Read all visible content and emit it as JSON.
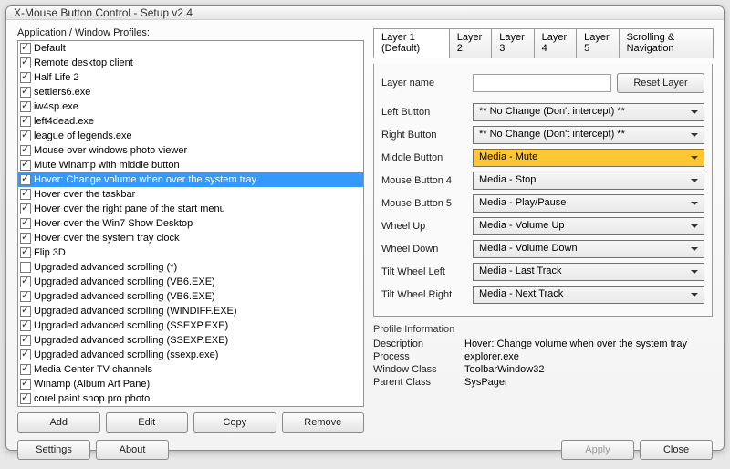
{
  "window": {
    "title": "X-Mouse Button Control - Setup v2.4"
  },
  "left": {
    "heading": "Application / Window Profiles:",
    "profiles": [
      {
        "label": "Default",
        "checked": true
      },
      {
        "label": "Remote desktop client",
        "checked": true
      },
      {
        "label": "Half Life 2",
        "checked": true
      },
      {
        "label": "settlers6.exe",
        "checked": true
      },
      {
        "label": "iw4sp.exe",
        "checked": true
      },
      {
        "label": "left4dead.exe",
        "checked": true
      },
      {
        "label": "league of legends.exe",
        "checked": true
      },
      {
        "label": "Mouse over windows photo viewer",
        "checked": true
      },
      {
        "label": "Mute Winamp with middle button",
        "checked": true
      },
      {
        "label": "Hover: Change volume when over the system tray",
        "checked": true,
        "selected": true
      },
      {
        "label": "Hover over the taskbar",
        "checked": true
      },
      {
        "label": "Hover over the right pane of the start menu",
        "checked": true
      },
      {
        "label": "Hover over the Win7 Show Desktop",
        "checked": true
      },
      {
        "label": "Hover over the system tray clock",
        "checked": true
      },
      {
        "label": "Flip 3D",
        "checked": true
      },
      {
        "label": "Upgraded advanced scrolling (*)",
        "checked": false
      },
      {
        "label": "Upgraded advanced scrolling (VB6.EXE)",
        "checked": true
      },
      {
        "label": "Upgraded advanced scrolling (VB6.EXE)",
        "checked": true
      },
      {
        "label": "Upgraded advanced scrolling (WINDIFF.EXE)",
        "checked": true
      },
      {
        "label": "Upgraded advanced scrolling (SSEXP.EXE)",
        "checked": true
      },
      {
        "label": "Upgraded advanced scrolling (SSEXP.EXE)",
        "checked": true
      },
      {
        "label": "Upgraded advanced scrolling (ssexp.exe)",
        "checked": true
      },
      {
        "label": "Media Center TV channels",
        "checked": true
      },
      {
        "label": "Winamp (Album Art Pane)",
        "checked": true
      },
      {
        "label": "corel paint shop pro photo",
        "checked": true
      }
    ],
    "buttons": {
      "add": "Add",
      "edit": "Edit",
      "copy": "Copy",
      "remove": "Remove"
    }
  },
  "tabs": {
    "items": [
      {
        "label": "Layer 1 (Default)",
        "active": true
      },
      {
        "label": "Layer 2"
      },
      {
        "label": "Layer 3"
      },
      {
        "label": "Layer 4"
      },
      {
        "label": "Layer 5"
      },
      {
        "label": "Scrolling & Navigation"
      }
    ]
  },
  "layer": {
    "name_label": "Layer name",
    "name_value": "",
    "reset": "Reset Layer",
    "rows": [
      {
        "label": "Left Button",
        "value": "** No Change (Don't intercept) **"
      },
      {
        "label": "Right Button",
        "value": "** No Change (Don't intercept) **"
      },
      {
        "label": "Middle Button",
        "value": "Media - Mute",
        "highlight": true
      },
      {
        "label": "Mouse Button 4",
        "value": "Media - Stop"
      },
      {
        "label": "Mouse Button 5",
        "value": "Media - Play/Pause"
      },
      {
        "label": "Wheel Up",
        "value": "Media - Volume Up"
      },
      {
        "label": "Wheel Down",
        "value": "Media - Volume Down"
      },
      {
        "label": "Tilt Wheel Left",
        "value": "Media - Last Track"
      },
      {
        "label": "Tilt Wheel Right",
        "value": "Media - Next Track"
      }
    ]
  },
  "info": {
    "heading": "Profile Information",
    "rows": [
      {
        "k": "Description",
        "v": "Hover: Change volume when over the system tray"
      },
      {
        "k": "Process",
        "v": "explorer.exe"
      },
      {
        "k": "Window Class",
        "v": "ToolbarWindow32"
      },
      {
        "k": "Parent Class",
        "v": "SysPager"
      }
    ]
  },
  "footer": {
    "settings": "Settings",
    "about": "About",
    "apply": "Apply",
    "close": "Close"
  }
}
